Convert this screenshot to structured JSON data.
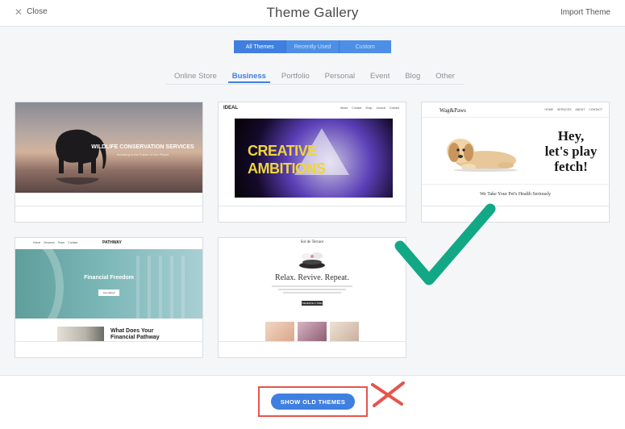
{
  "header": {
    "close_label": "Close",
    "title": "Theme Gallery",
    "import_label": "Import Theme"
  },
  "segments": [
    {
      "label": "All Themes",
      "active": true
    },
    {
      "label": "Recently Used",
      "active": false
    },
    {
      "label": "Custom",
      "active": false
    }
  ],
  "tabs": [
    {
      "label": "Online Store",
      "active": false
    },
    {
      "label": "Business",
      "active": true
    },
    {
      "label": "Portfolio",
      "active": false
    },
    {
      "label": "Personal",
      "active": false
    },
    {
      "label": "Event",
      "active": false
    },
    {
      "label": "Blog",
      "active": false
    },
    {
      "label": "Other",
      "active": false
    }
  ],
  "themes": {
    "wildlife": {
      "heading": "WILDLIFE CONSERVATION SERVICES",
      "subheading": "Investing in the Future of Our Planet"
    },
    "creative": {
      "logo": "IDEAL",
      "nav": "About Contact Shop Journal Contact",
      "line1": "CREATIVE",
      "line2": "AMBITIONS"
    },
    "wag": {
      "logo": "Wag&Paws",
      "nav": "HOME SERVICES ABOUT CONTACT",
      "hero_line1": "Hey,",
      "hero_line2": "let's play",
      "hero_line3": "fetch!",
      "subheading": "We Take Your Pet's Health Seriously"
    },
    "pathway": {
      "logo": "PATHWAY",
      "nav": "Home Services Team Contact",
      "heading": "Financial Freedom",
      "button": "Get started",
      "section_line1": "What Does Your",
      "section_line2": "Financial Pathway"
    },
    "sol": {
      "logo": "Sol de Terrace",
      "heading": "Relax. Revive. Repeat.",
      "button": "RESERVE A TIME"
    }
  },
  "footer": {
    "show_old_label": "SHOW OLD THEMES"
  },
  "colors": {
    "accent": "#3f7fe0",
    "annotation_red": "#e4554d",
    "annotation_green": "#12a886"
  }
}
